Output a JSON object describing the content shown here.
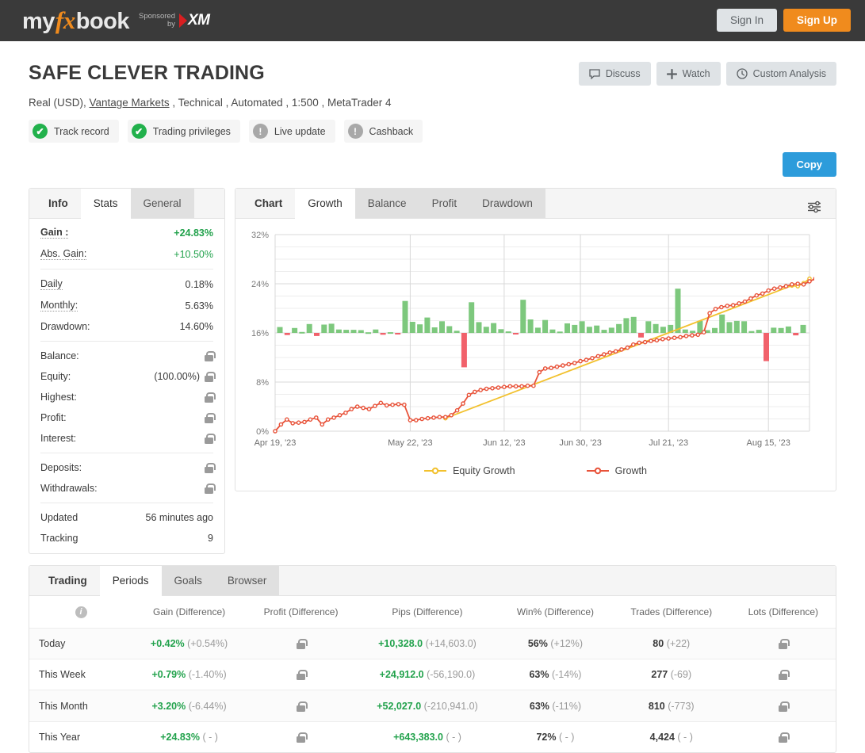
{
  "nav": {
    "logo_my": "my",
    "logo_fx": "fx",
    "logo_book": "book",
    "sponsored_line1": "Sponsored",
    "sponsored_line2": "by",
    "xm": "XM",
    "sign_in": "Sign In",
    "sign_up": "Sign Up"
  },
  "header": {
    "title": "SAFE CLEVER TRADING",
    "subline_pre": "Real (USD), ",
    "broker": "Vantage Markets",
    "subline_post": " , Technical , Automated , 1:500 , MetaTrader 4",
    "actions": [
      {
        "label": "Discuss",
        "icon": "comment-icon"
      },
      {
        "label": "Watch",
        "icon": "plus-icon"
      },
      {
        "label": "Custom Analysis",
        "icon": "clock-icon"
      }
    ],
    "badges": [
      {
        "label": "Track record",
        "state": "ok",
        "glyph": "✔"
      },
      {
        "label": "Trading privileges",
        "state": "ok",
        "glyph": "✔"
      },
      {
        "label": "Live update",
        "state": "no",
        "glyph": "!"
      },
      {
        "label": "Cashback",
        "state": "no",
        "glyph": "!"
      }
    ],
    "copy_label": "Copy"
  },
  "info_panel": {
    "tabs": [
      {
        "label": "Info",
        "active": false,
        "bold": true
      },
      {
        "label": "Stats",
        "active": true,
        "bold": false
      },
      {
        "label": "General",
        "active": false,
        "bold": false
      }
    ],
    "group1": [
      {
        "key": "Gain :",
        "value": "+24.83%",
        "style": "green-b",
        "key_style": "dot b"
      },
      {
        "key": "Abs. Gain:",
        "value": "+10.50%",
        "style": "green",
        "key_style": "dot"
      }
    ],
    "group2": [
      {
        "key": "Daily",
        "value": "0.18%",
        "key_style": "dot"
      },
      {
        "key": "Monthly:",
        "value": "5.63%",
        "key_style": "dot"
      },
      {
        "key": "Drawdown:",
        "value": "14.60%",
        "key_style": ""
      }
    ],
    "group3": [
      {
        "key": "Balance:",
        "value": "",
        "locked": true
      },
      {
        "key": "Equity:",
        "value": "(100.00%)",
        "locked": true
      },
      {
        "key": "Highest:",
        "value": "",
        "locked": true
      },
      {
        "key": "Profit:",
        "value": "",
        "locked": true
      },
      {
        "key": "Interest:",
        "value": "",
        "locked": true
      }
    ],
    "group4": [
      {
        "key": "Deposits:",
        "value": "",
        "locked": true
      },
      {
        "key": "Withdrawals:",
        "value": "",
        "locked": true
      }
    ],
    "group5": [
      {
        "key": "Updated",
        "value": "56 minutes ago"
      },
      {
        "key": "Tracking",
        "value": "9"
      }
    ]
  },
  "chart_panel": {
    "tabs": [
      {
        "label": "Chart",
        "active": false,
        "bold": true
      },
      {
        "label": "Growth",
        "active": true,
        "bold": false
      },
      {
        "label": "Balance",
        "active": false,
        "bold": false
      },
      {
        "label": "Profit",
        "active": false,
        "bold": false
      },
      {
        "label": "Drawdown",
        "active": false,
        "bold": false
      }
    ],
    "settings_icon": "sliders-icon"
  },
  "chart_data": {
    "type": "line",
    "title": "",
    "xlabel": "",
    "ylabel": "",
    "ylim": [
      0,
      32
    ],
    "yticks": [
      "0%",
      "8%",
      "16%",
      "24%",
      "32%"
    ],
    "ytick_values": [
      0,
      8,
      16,
      24,
      32
    ],
    "grid": true,
    "legend_position": "bottom",
    "xticks": [
      "Apr 19, '23",
      "May 22, '23",
      "Jun 12, '23",
      "Jun 30, '23",
      "Jul 21, '23",
      "Aug 15, '23"
    ],
    "xtick_positions": [
      0,
      23,
      39,
      52,
      67,
      84
    ],
    "n_points": 92,
    "series": [
      {
        "name": "Growth",
        "color": "#e8533a",
        "type": "line",
        "values": [
          0.0,
          1.1,
          1.9,
          1.3,
          1.4,
          1.5,
          1.9,
          2.2,
          1.1,
          1.9,
          2.2,
          2.6,
          3.0,
          3.6,
          4.0,
          3.8,
          3.6,
          4.1,
          4.6,
          4.2,
          4.3,
          4.4,
          4.3,
          1.8,
          1.8,
          2.0,
          2.1,
          2.2,
          2.3,
          2.3,
          2.6,
          3.4,
          4.5,
          5.9,
          6.4,
          6.7,
          6.9,
          7.0,
          7.1,
          7.2,
          7.3,
          7.3,
          7.3,
          7.4,
          7.4,
          9.6,
          10.2,
          10.3,
          10.5,
          10.7,
          10.9,
          11.1,
          11.4,
          11.6,
          11.9,
          12.2,
          12.5,
          12.8,
          13.0,
          13.3,
          13.6,
          14.1,
          14.4,
          14.5,
          14.7,
          14.8,
          15.0,
          15.1,
          15.2,
          15.3,
          15.5,
          15.6,
          15.7,
          16.1,
          19.2,
          19.9,
          20.2,
          20.4,
          20.5,
          20.8,
          21.1,
          21.6,
          22.1,
          22.4,
          22.9,
          23.2,
          23.4,
          23.6,
          23.9,
          24.0,
          23.9,
          24.4,
          24.83
        ]
      },
      {
        "name": "Equity Growth",
        "color": "#f2c12e",
        "type": "line",
        "values": [
          null,
          null,
          null,
          null,
          null,
          null,
          null,
          null,
          null,
          null,
          null,
          null,
          null,
          null,
          null,
          null,
          null,
          null,
          null,
          null,
          null,
          null,
          null,
          null,
          null,
          null,
          null,
          null,
          null,
          2.1,
          null,
          null,
          null,
          null,
          null,
          null,
          null,
          null,
          null,
          null,
          null,
          null,
          null,
          null,
          null,
          null,
          null,
          null,
          null,
          null,
          null,
          null,
          null,
          null,
          null,
          null,
          null,
          null,
          null,
          null,
          null,
          null,
          null,
          null,
          null,
          null,
          null,
          null,
          null,
          null,
          null,
          null,
          null,
          null,
          null,
          null,
          null,
          null,
          null,
          null,
          null,
          null,
          null,
          null,
          null,
          null,
          null,
          null,
          23.7,
          23.6,
          24.1,
          24.83
        ]
      },
      {
        "name": "Daily Change",
        "color_positive": "#7dc87d",
        "color_negative": "#f1616b",
        "type": "bar",
        "baseline": 16,
        "values": [
          0.95,
          -0.35,
          0.8,
          0.15,
          1.45,
          -0.5,
          1.35,
          1.5,
          0.55,
          0.5,
          0.5,
          0.45,
          0.1,
          0.55,
          -0.3,
          0.12,
          -0.25,
          5.2,
          1.8,
          1.4,
          2.5,
          0.9,
          1.9,
          1.1,
          0.35,
          -5.6,
          5.0,
          1.75,
          1.0,
          1.6,
          0.6,
          0.25,
          -0.12,
          5.4,
          2.2,
          0.85,
          2.1,
          0.55,
          0.22,
          1.55,
          1.3,
          1.9,
          1.0,
          1.2,
          0.5,
          0.85,
          1.45,
          2.4,
          2.6,
          -0.75,
          1.9,
          1.45,
          1.0,
          1.3,
          7.2,
          0.55,
          0.35,
          1.95,
          0.45,
          0.8,
          3.0,
          1.75,
          1.95,
          1.9,
          0.3,
          0.5,
          -4.6,
          0.85,
          0.8,
          1.05,
          -0.4,
          1.3
        ]
      }
    ],
    "legend": [
      {
        "name": "Equity Growth",
        "color": "#f2c12e"
      },
      {
        "name": "Growth",
        "color": "#e8533a"
      }
    ]
  },
  "bottom_panel": {
    "tabs": [
      {
        "label": "Trading",
        "active": false,
        "bold": true
      },
      {
        "label": "Periods",
        "active": true,
        "bold": false
      },
      {
        "label": "Goals",
        "active": false,
        "bold": false
      },
      {
        "label": "Browser",
        "active": false,
        "bold": false
      }
    ],
    "columns": [
      "",
      "Gain (Difference)",
      "Profit (Difference)",
      "Pips (Difference)",
      "Win% (Difference)",
      "Trades (Difference)",
      "Lots (Difference)"
    ],
    "rows": [
      {
        "period": "Today",
        "gain": "+0.42%",
        "gain_diff": "(+0.54%)",
        "profit_locked": true,
        "pips": "+10,328.0",
        "pips_diff": "(+14,603.0)",
        "win": "56%",
        "win_diff": "(+12%)",
        "trades": "80",
        "trades_diff": "(+22)",
        "lots_locked": true
      },
      {
        "period": "This Week",
        "gain": "+0.79%",
        "gain_diff": "(-1.40%)",
        "profit_locked": true,
        "pips": "+24,912.0",
        "pips_diff": "(-56,190.0)",
        "win": "63%",
        "win_diff": "(-14%)",
        "trades": "277",
        "trades_diff": "(-69)",
        "lots_locked": true
      },
      {
        "period": "This Month",
        "gain": "+3.20%",
        "gain_diff": "(-6.44%)",
        "profit_locked": true,
        "pips": "+52,027.0",
        "pips_diff": "(-210,941.0)",
        "win": "63%",
        "win_diff": "(-11%)",
        "trades": "810",
        "trades_diff": "(-773)",
        "lots_locked": true
      },
      {
        "period": "This Year",
        "gain": "+24.83%",
        "gain_diff": "( - )",
        "profit_locked": true,
        "pips": "+643,383.0",
        "pips_diff": "( - )",
        "win": "72%",
        "win_diff": "( - )",
        "trades": "4,424",
        "trades_diff": "( - )",
        "lots_locked": true
      }
    ]
  }
}
